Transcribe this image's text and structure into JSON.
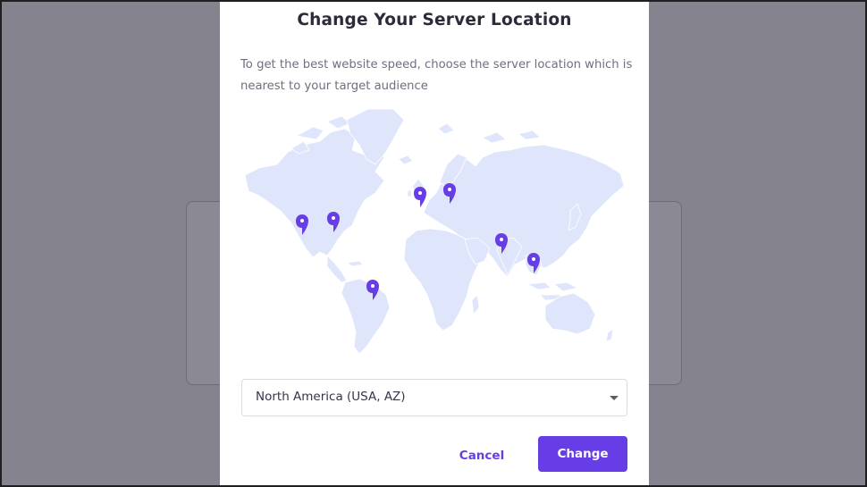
{
  "modal": {
    "title": "Change Your Server Location",
    "description": "To get the best website speed, choose the server location which is nearest to your target audience"
  },
  "map": {
    "land_color": "#dfe5fb",
    "pin_color": "#673de6",
    "pins": [
      {
        "name": "map-pin-usa-west"
      },
      {
        "name": "map-pin-usa-east"
      },
      {
        "name": "map-pin-brazil"
      },
      {
        "name": "map-pin-uk"
      },
      {
        "name": "map-pin-lithuania"
      },
      {
        "name": "map-pin-india"
      },
      {
        "name": "map-pin-singapore"
      }
    ]
  },
  "location_select": {
    "selected": "North America (USA, AZ)"
  },
  "actions": {
    "cancel_label": "Cancel",
    "change_label": "Change"
  },
  "colors": {
    "accent": "#673de6",
    "backdrop": "#85838d"
  }
}
